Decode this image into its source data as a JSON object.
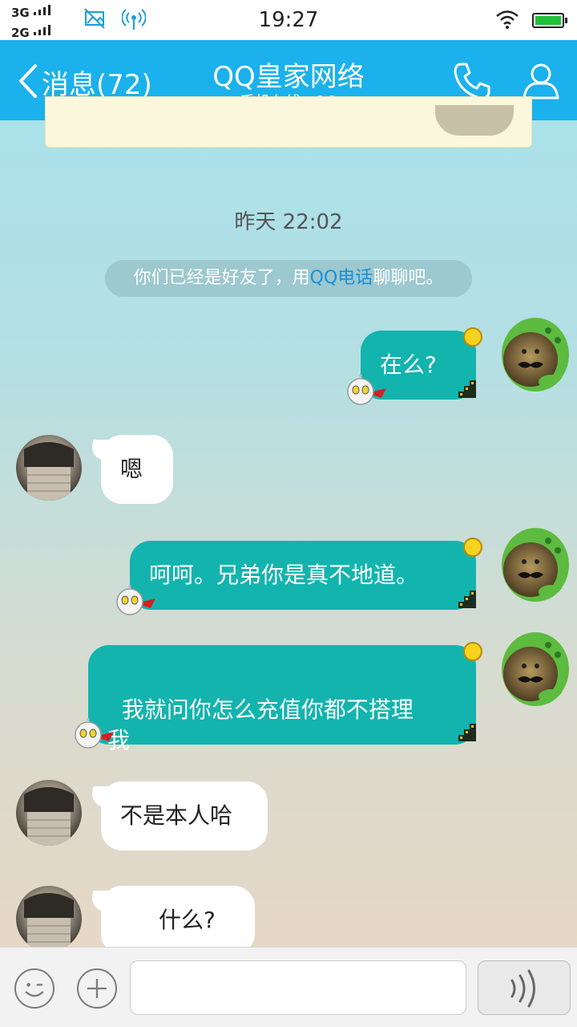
{
  "status_bar": {
    "network_1": "3G",
    "network_2": "2G",
    "time": "19:27",
    "icons": [
      "no-photo-icon",
      "hotspot-icon",
      "wifi-icon",
      "battery-icon"
    ]
  },
  "header": {
    "back_label": "消息(72)",
    "title": "QQ皇家网络",
    "subtitle": "手机在线 - 2G",
    "icons": [
      "back-chevron-icon",
      "phone-icon",
      "profile-icon"
    ]
  },
  "chat": {
    "timestamp": "昨天 22:02",
    "system_message": {
      "prefix": "你们已经是好友了，用",
      "link": "QQ电话",
      "suffix": "聊聊吧。"
    },
    "messages": [
      {
        "from": "me",
        "text": "在么?"
      },
      {
        "from": "friend",
        "text": "嗯"
      },
      {
        "from": "me",
        "text": "呵呵。兄弟你是真不地道。"
      },
      {
        "from": "me",
        "text": "我就问你怎么充值你都不搭理\n我"
      },
      {
        "from": "friend",
        "text": "不是本人哈"
      },
      {
        "from": "friend",
        "text": "什么?"
      }
    ]
  },
  "input_bar": {
    "placeholder": "",
    "icons": [
      "emoji-icon",
      "plus-icon",
      "voice-icon"
    ]
  },
  "colors": {
    "header_bg": "#1ab1ec",
    "outgoing_bubble": "#13b4ae",
    "incoming_bubble": "#ffffff",
    "link": "#1a8fd8"
  }
}
